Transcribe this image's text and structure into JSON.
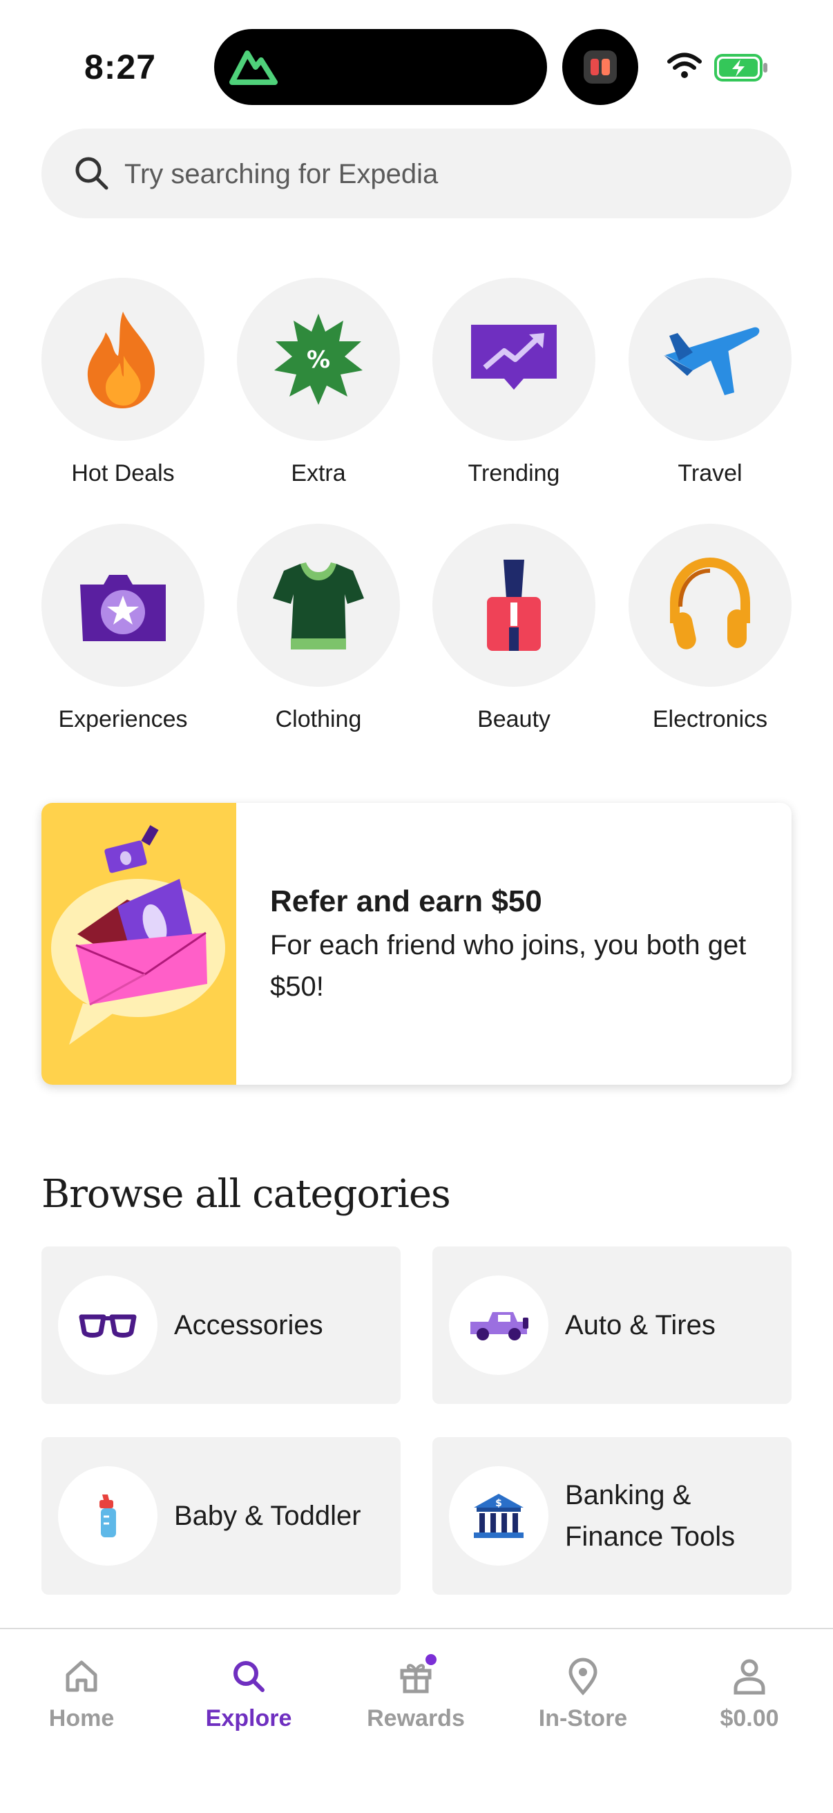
{
  "status_bar": {
    "time": "8:27"
  },
  "search": {
    "placeholder": "Try searching for  Expedia"
  },
  "categories": [
    {
      "label": "Hot Deals",
      "icon": "flame-icon"
    },
    {
      "label": "Extra",
      "icon": "percent-badge-icon"
    },
    {
      "label": "Trending",
      "icon": "trending-chart-icon"
    },
    {
      "label": "Travel",
      "icon": "airplane-icon"
    },
    {
      "label": "Experiences",
      "icon": "camera-star-icon"
    },
    {
      "label": "Clothing",
      "icon": "tshirt-icon"
    },
    {
      "label": "Beauty",
      "icon": "nail-polish-icon"
    },
    {
      "label": "Electronics",
      "icon": "headphones-icon"
    }
  ],
  "refer": {
    "title": "Refer and earn $50",
    "body": "For each friend who joins, you both get $50!"
  },
  "browse": {
    "title": "Browse all categories",
    "tiles": [
      {
        "label": "Accessories",
        "icon": "glasses-icon"
      },
      {
        "label": "Auto & Tires",
        "icon": "car-icon"
      },
      {
        "label": "Baby & Toddler",
        "icon": "baby-bottle-icon"
      },
      {
        "label": "Banking & Finance Tools",
        "icon": "bank-icon"
      }
    ]
  },
  "nav": {
    "items": [
      {
        "label": "Home",
        "icon": "home-icon"
      },
      {
        "label": "Explore",
        "icon": "search-icon",
        "active": true
      },
      {
        "label": "Rewards",
        "icon": "gift-icon"
      },
      {
        "label": "In-Store",
        "icon": "location-pin-icon"
      },
      {
        "label": "$0.00",
        "icon": "person-icon"
      }
    ]
  },
  "colors": {
    "accent": "#6f2fc0",
    "surface": "#f2f2f2",
    "refer_bg": "#ffd24c"
  }
}
